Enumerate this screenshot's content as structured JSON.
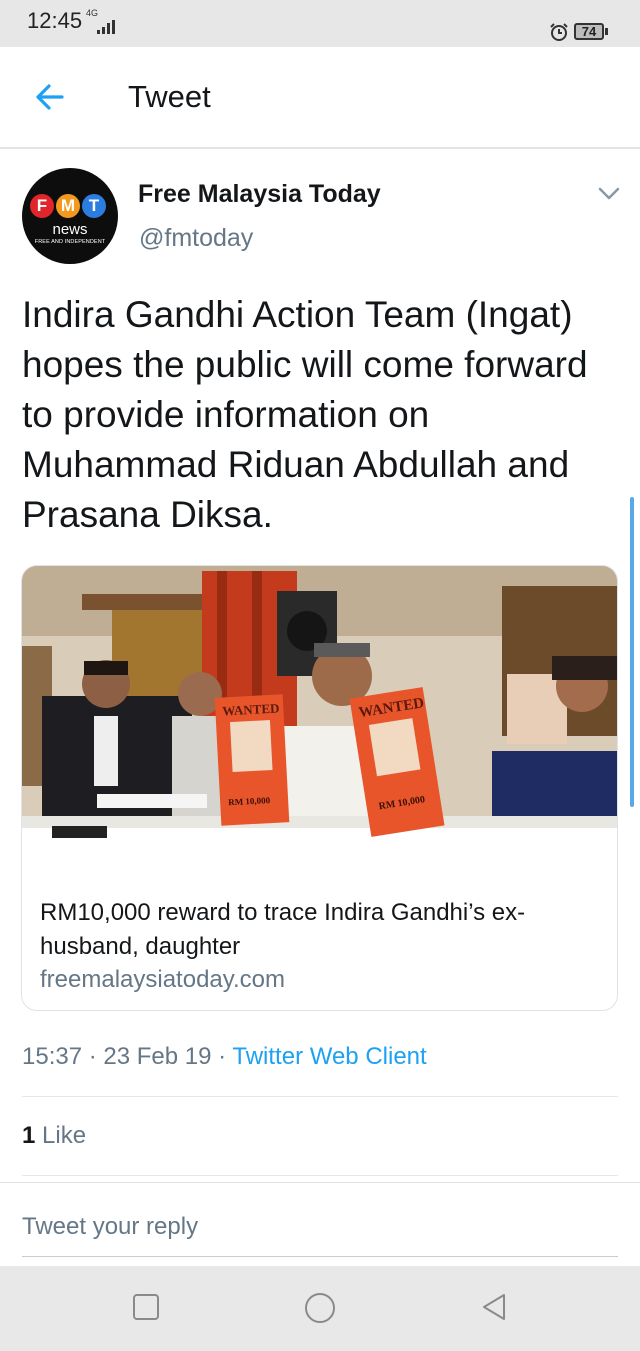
{
  "status_bar": {
    "time": "12:45",
    "network": "4G",
    "battery": "74"
  },
  "app_bar": {
    "title": "Tweet",
    "back_icon": "arrow-left-icon"
  },
  "tweet": {
    "author": {
      "name": "Free Malaysia Today",
      "handle": "@fmtoday",
      "avatar": {
        "letters": [
          "F",
          "M",
          "T"
        ],
        "word": "news",
        "tagline": "FREE AND INDEPENDENT"
      }
    },
    "text": "Indira Gandhi Action Team (Ingat) hopes the public will come forward to provide information on Muhammad Riduan Abdullah and Prasana Diksa.",
    "card": {
      "poster_heading": "WANTED",
      "poster_reward": "RM 10,000",
      "title": "RM10,000 reward to trace Indira Gandhi’s ex-husband, daughter",
      "domain": "freemalaysiatoday.com"
    },
    "meta": {
      "time": "15:37",
      "date": "23 Feb 19",
      "separator": " · ",
      "client": "Twitter Web Client"
    },
    "likes": {
      "count": "1",
      "label": "Like"
    }
  },
  "reply": {
    "placeholder": "Tweet your reply"
  },
  "colors": {
    "link": "#1da1f2",
    "secondary": "#657786",
    "primary": "#14171a",
    "fmt_red": "#e0252b",
    "fmt_orange": "#f39a1e",
    "fmt_blue": "#2b7de0"
  }
}
